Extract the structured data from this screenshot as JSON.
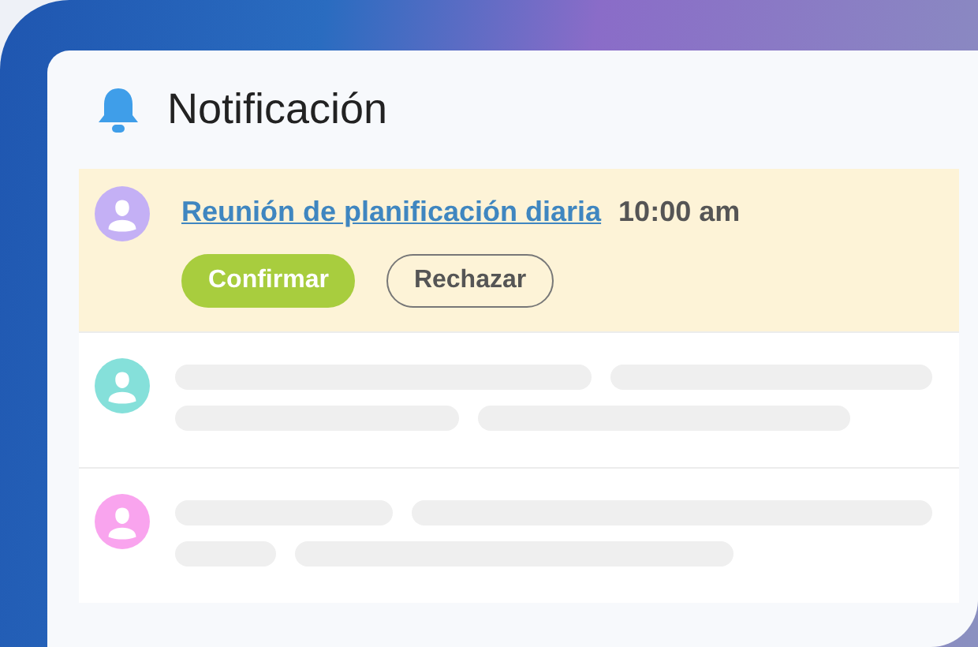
{
  "panel": {
    "title": "Notificación"
  },
  "notifications": [
    {
      "kind": "event",
      "color": "#c4b0f5",
      "title": "Reunión de planificación diaria",
      "time": "10:00 am",
      "actions": [
        {
          "label": "Confirmar",
          "kind": "primary"
        },
        {
          "label": "Rechazar",
          "kind": "outline"
        }
      ]
    },
    {
      "kind": "placeholder",
      "color": "#85e0da"
    },
    {
      "kind": "placeholder",
      "color": "#f9a4ee"
    }
  ]
}
